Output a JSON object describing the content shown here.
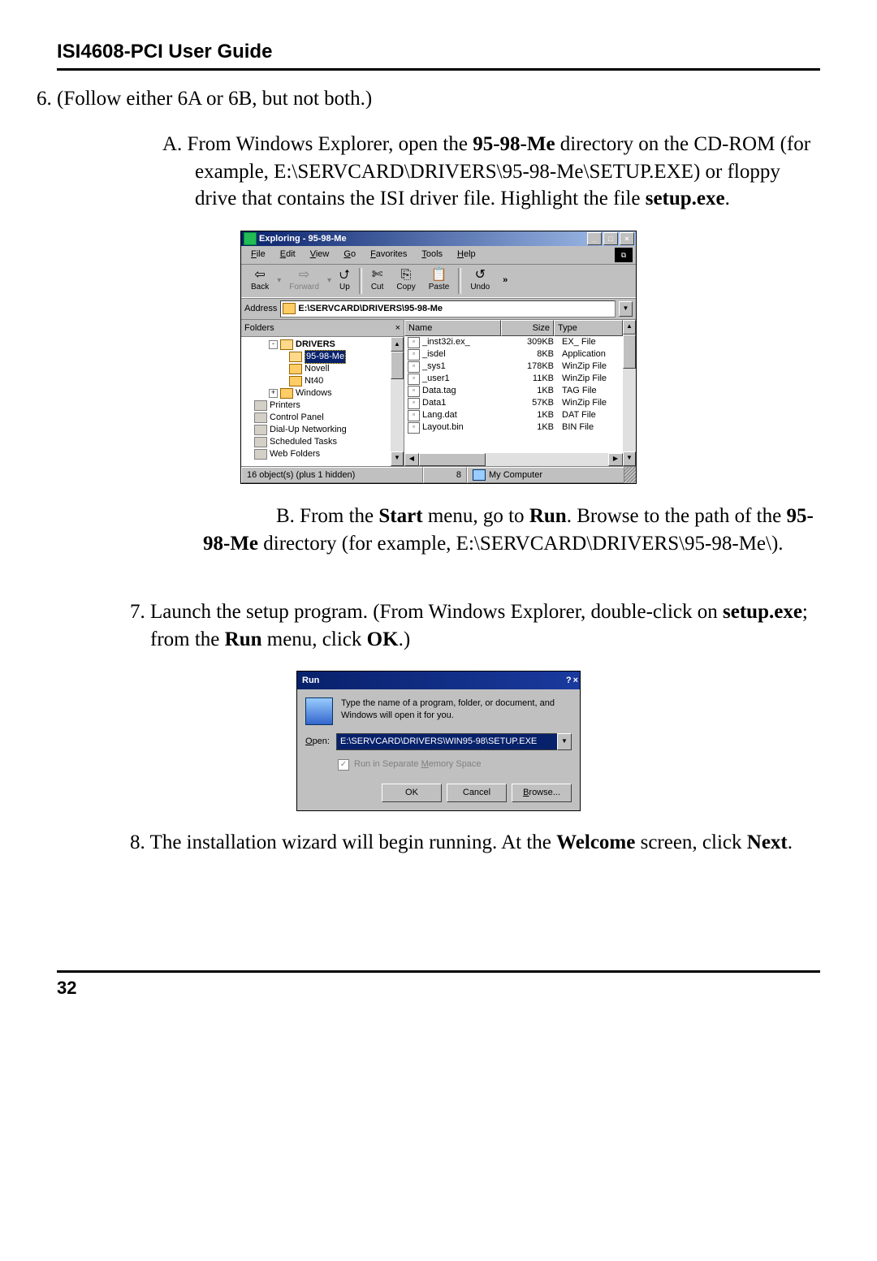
{
  "header": "ISI4608-PCI User Guide",
  "step6": {
    "line": "6. (Follow either 6A or 6B, but not both.)",
    "A": {
      "prefix": "A.   From Windows Explorer, open the ",
      "dir1": "95-98-Me",
      "mid1": " directory on the CD-ROM (for example, E:\\SERVCARD\\DRIVERS\\95-98-Me\\SETUP.EXE) or floppy drive that contains the ISI driver file.  Highlight the file ",
      "file": "setup.exe",
      "end": "."
    },
    "B": {
      "prefix": "B.  From the ",
      "b1": "Start",
      "mid1": " menu, go to ",
      "b2": "Run",
      "mid2": ".  Browse to the  path of the ",
      "b3": "95-98-Me",
      "mid3": " directory (for example, E:\\SERVCARD\\DRIVERS\\95-98-Me\\)."
    }
  },
  "step7": {
    "prefix": "7. Launch the setup program.  (From Windows Explorer, double-click on ",
    "b1": "setup.exe",
    "mid1": "; from the ",
    "b2": "Run",
    "mid2": " menu, click ",
    "b3": "OK",
    "end": ".)"
  },
  "step8": {
    "prefix": "8. The installation wizard will begin running. At the ",
    "b1": "Welcome",
    "mid1": " screen, click ",
    "b2": "Next",
    "end": "."
  },
  "explorer": {
    "title": "Exploring  -  95-98-Me",
    "menus": {
      "file": "File",
      "edit": "Edit",
      "view": "View",
      "go": "Go",
      "favorites": "Favorites",
      "tools": "Tools",
      "help": "Help"
    },
    "menuUnderline": {
      "file": "F",
      "edit": "E",
      "view": "V",
      "go": "G",
      "favorites": "F",
      "tools": "T",
      "help": "H"
    },
    "toolbar": {
      "back": "Back",
      "forward": "Forward",
      "up": "Up",
      "cut": "Cut",
      "copy": "Copy",
      "paste": "Paste",
      "undo": "Undo"
    },
    "addressLabel": "Address",
    "addressVal": "E:\\SERVCARD\\DRIVERS\\95-98-Me",
    "foldersLabel": "Folders",
    "tree": [
      {
        "indent": 30,
        "exp": "-",
        "label": "DRIVERS",
        "bold": true,
        "open": true
      },
      {
        "indent": 55,
        "exp": "",
        "label": "95-98-Me",
        "sel": true,
        "open": true
      },
      {
        "indent": 55,
        "exp": "",
        "label": "Novell"
      },
      {
        "indent": 55,
        "exp": "",
        "label": "Nt40"
      },
      {
        "indent": 30,
        "exp": "+",
        "label": "Windows"
      },
      {
        "indent": 12,
        "exp": "",
        "label": "Printers",
        "sys": true
      },
      {
        "indent": 12,
        "exp": "",
        "label": "Control Panel",
        "sys": true
      },
      {
        "indent": 12,
        "exp": "",
        "label": "Dial-Up Networking",
        "sys": true
      },
      {
        "indent": 12,
        "exp": "",
        "label": "Scheduled Tasks",
        "sys": true
      },
      {
        "indent": 12,
        "exp": "",
        "label": "Web Folders",
        "sys": true
      }
    ],
    "cols": {
      "name": "Name",
      "size": "Size",
      "type": "Type"
    },
    "files": [
      {
        "name": "_inst32i.ex_",
        "size": "309KB",
        "type": "EX_ File"
      },
      {
        "name": "_isdel",
        "size": "8KB",
        "type": "Application"
      },
      {
        "name": "_sys1",
        "size": "178KB",
        "type": "WinZip File"
      },
      {
        "name": "_user1",
        "size": "11KB",
        "type": "WinZip File"
      },
      {
        "name": "Data.tag",
        "size": "1KB",
        "type": "TAG File"
      },
      {
        "name": "Data1",
        "size": "57KB",
        "type": "WinZip File"
      },
      {
        "name": "Lang.dat",
        "size": "1KB",
        "type": "DAT File"
      },
      {
        "name": "Layout.bin",
        "size": "1KB",
        "type": "BIN File"
      }
    ],
    "status": {
      "left": "16 object(s) (plus 1 hidden)",
      "mid": "8",
      "right": "My Computer"
    }
  },
  "run": {
    "title": "Run",
    "desc": "Type the name of a program, folder, or document, and Windows will open it for you.",
    "openLabel": "Open:",
    "openVal": "E:\\SERVCARD\\DRIVERS\\WIN95-98\\SETUP.EXE",
    "chk": "Run in Separate Memory Space",
    "btns": {
      "ok": "OK",
      "cancel": "Cancel",
      "browse": "Browse..."
    }
  },
  "pageNumber": "32"
}
